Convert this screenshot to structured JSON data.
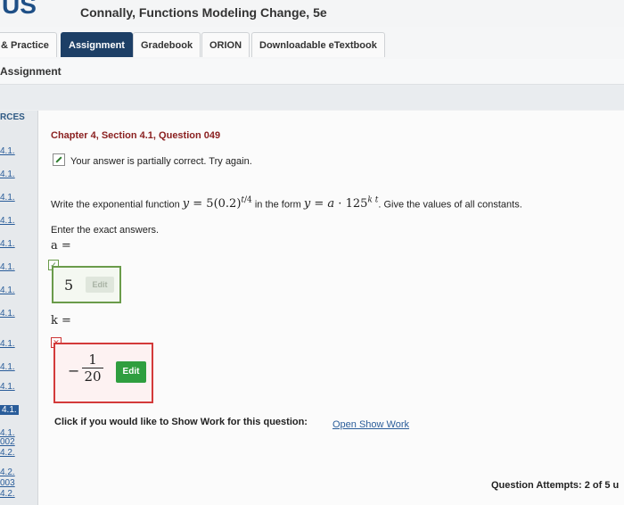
{
  "header": {
    "logo": "US",
    "book_title": "Connally, Functions Modeling Change, 5e"
  },
  "tabs": [
    {
      "label": "& Practice"
    },
    {
      "label": "Assignment"
    },
    {
      "label": "Gradebook"
    },
    {
      "label": "ORION"
    },
    {
      "label": "Downloadable eTextbook"
    }
  ],
  "assignment_title": "Assignment",
  "sidebar": {
    "heading": "RCES",
    "items": [
      "4.1.",
      "4.1.",
      "4.1.",
      "4.1.",
      "4.1.",
      "4.1.",
      "4.1.",
      "4.1.",
      "4.1.",
      "4.1.",
      "4.1.",
      "4.1.",
      "4.1.",
      "002",
      "4.2.",
      "4.2.",
      "003",
      "4.2."
    ]
  },
  "question": {
    "title": "Chapter 4, Section 4.1, Question 049",
    "status": "Your answer is partially correct.  Try again.",
    "instruction_prefix": "Write the exponential function",
    "instruction_mid": "in the form",
    "instruction_suffix": ". Give the values of all constants.",
    "exact": "Enter the exact answers.",
    "a_label": "a =",
    "a_value": "5",
    "k_label": "k =",
    "k_sign": "−",
    "k_num": "1",
    "k_den": "20",
    "edit_label": "Edit"
  },
  "show_work": {
    "prompt": "Click if you would like to Show Work for this question:",
    "link": "Open Show Work"
  },
  "attempts": "Question Attempts: 2 of 5 u"
}
